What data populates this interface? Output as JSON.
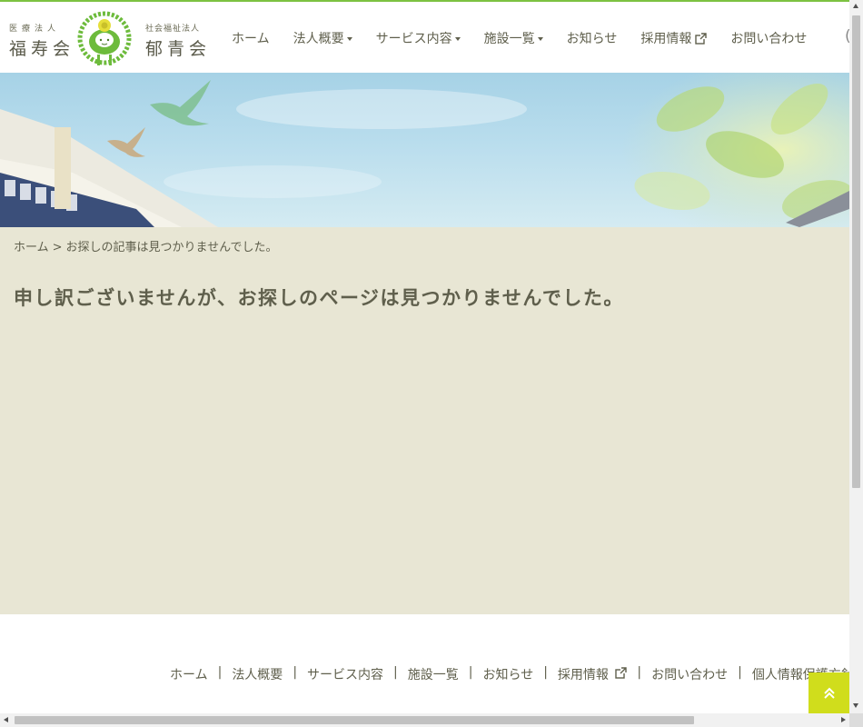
{
  "header": {
    "logo_left": {
      "sub": "医療法人",
      "main": "福寿会"
    },
    "logo_right": {
      "sub": "社会福祉法人",
      "main": "郁青会"
    },
    "nav": [
      {
        "label": "ホーム",
        "dropdown": false,
        "external": false
      },
      {
        "label": "法人概要",
        "dropdown": true,
        "external": false
      },
      {
        "label": "サービス内容",
        "dropdown": true,
        "external": false
      },
      {
        "label": "施設一覧",
        "dropdown": true,
        "external": false
      },
      {
        "label": "お知らせ",
        "dropdown": false,
        "external": false
      },
      {
        "label": "採用情報",
        "dropdown": false,
        "external": true
      },
      {
        "label": "お問い合わせ",
        "dropdown": false,
        "external": false
      }
    ],
    "nav_overflow": "("
  },
  "breadcrumb": {
    "home": "ホーム",
    "separator": ">",
    "current": "お探しの記事は見つかりませんでした。"
  },
  "main": {
    "message": "申し訳ございませんが、お探しのページは見つかりませんでした。"
  },
  "footer": {
    "nav": [
      {
        "label": "ホーム",
        "external": false
      },
      {
        "label": "法人概要",
        "external": false
      },
      {
        "label": "サービス内容",
        "external": false
      },
      {
        "label": "施設一覧",
        "external": false
      },
      {
        "label": "お知らせ",
        "external": false
      },
      {
        "label": "採用情報",
        "external": true
      },
      {
        "label": "お問い合わせ",
        "external": false
      },
      {
        "label": "個人情報保護方針",
        "external": false
      }
    ],
    "separator": "|"
  },
  "icons": {
    "to_top": "double-chevron-up-icon",
    "external": "external-link-icon",
    "logo": "sheep-wreath-logo-icon"
  },
  "colors": {
    "accent_green": "#7cc242",
    "content_bg": "#e8e6d4",
    "to_top_bg": "#d0dd1c",
    "text": "#5f5f4c"
  }
}
